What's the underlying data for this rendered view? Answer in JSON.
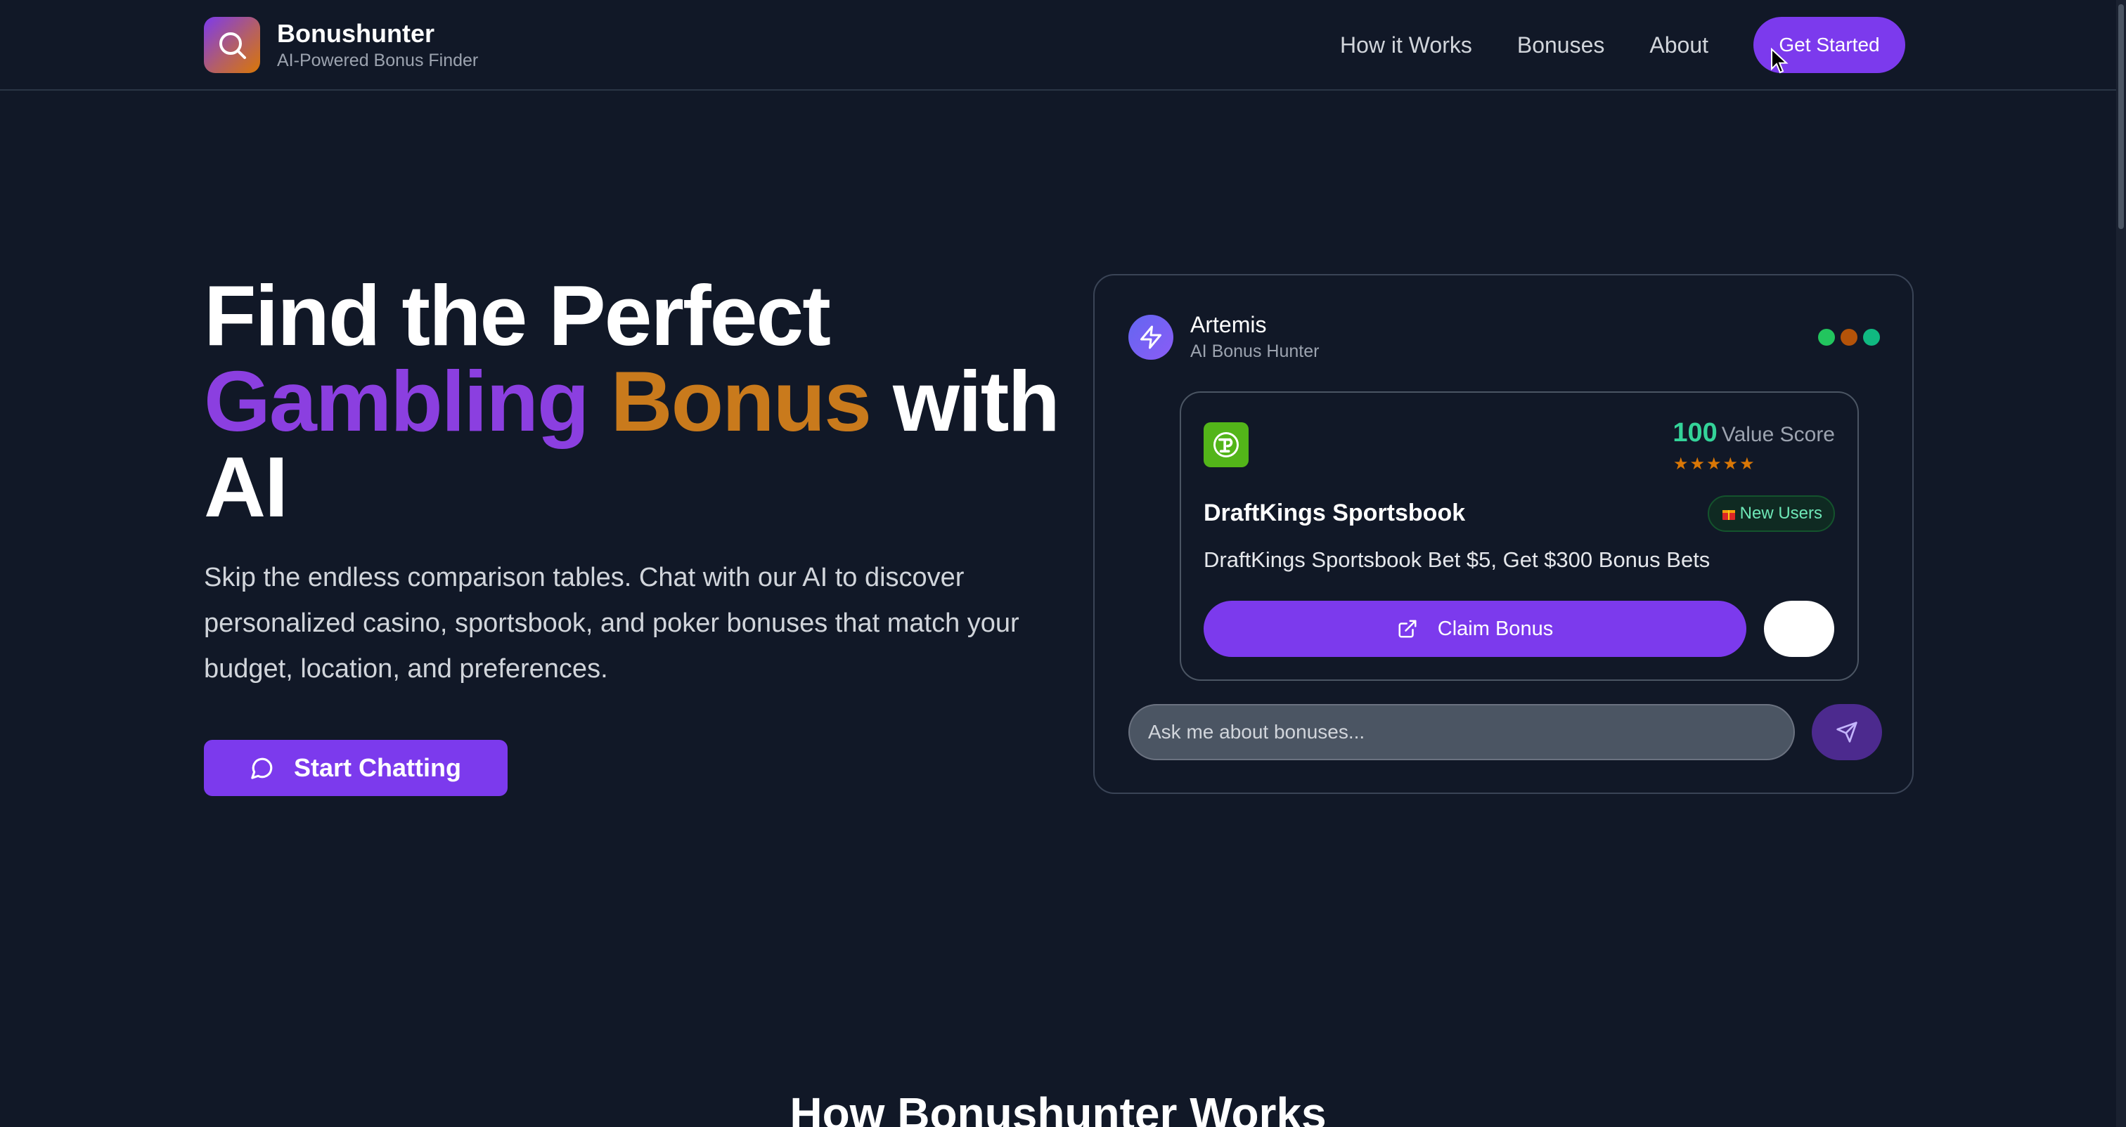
{
  "nav": {
    "brand_name": "Bonushunter",
    "brand_tagline": "AI-Powered Bonus Finder",
    "links": [
      "How it Works",
      "Bonuses",
      "About"
    ],
    "cta_label": "Get Started"
  },
  "hero": {
    "title_line1": "Find the Perfect",
    "title_grad_1": "Gambling",
    "title_grad_2": "Bonus",
    "title_after": "with",
    "title_line3": "AI",
    "description": "Skip the endless comparison tables. Chat with our AI to discover personalized casino, sportsbook, and poker bonuses that match your budget, location, and preferences.",
    "button_label": "Start Chatting"
  },
  "chat": {
    "agent_name": "Artemis",
    "agent_role": "AI Bonus Hunter",
    "status_dots": [
      "#22c55e",
      "#d97706",
      "#10b981"
    ],
    "offer": {
      "score": "100",
      "score_label": "Value Score",
      "stars": 5,
      "name": "DraftKings Sportsbook",
      "badge": "New Users",
      "description": "DraftKings Sportsbook Bet $5, Get $300 Bonus Bets",
      "claim_label": "Claim Bonus"
    },
    "input_placeholder": "Ask me about bonuses..."
  },
  "section": {
    "title": "How Bonushunter Works"
  },
  "colors": {
    "accent": "#7c3aed",
    "background": "#111827",
    "score": "#34d399",
    "star": "#d97706"
  }
}
